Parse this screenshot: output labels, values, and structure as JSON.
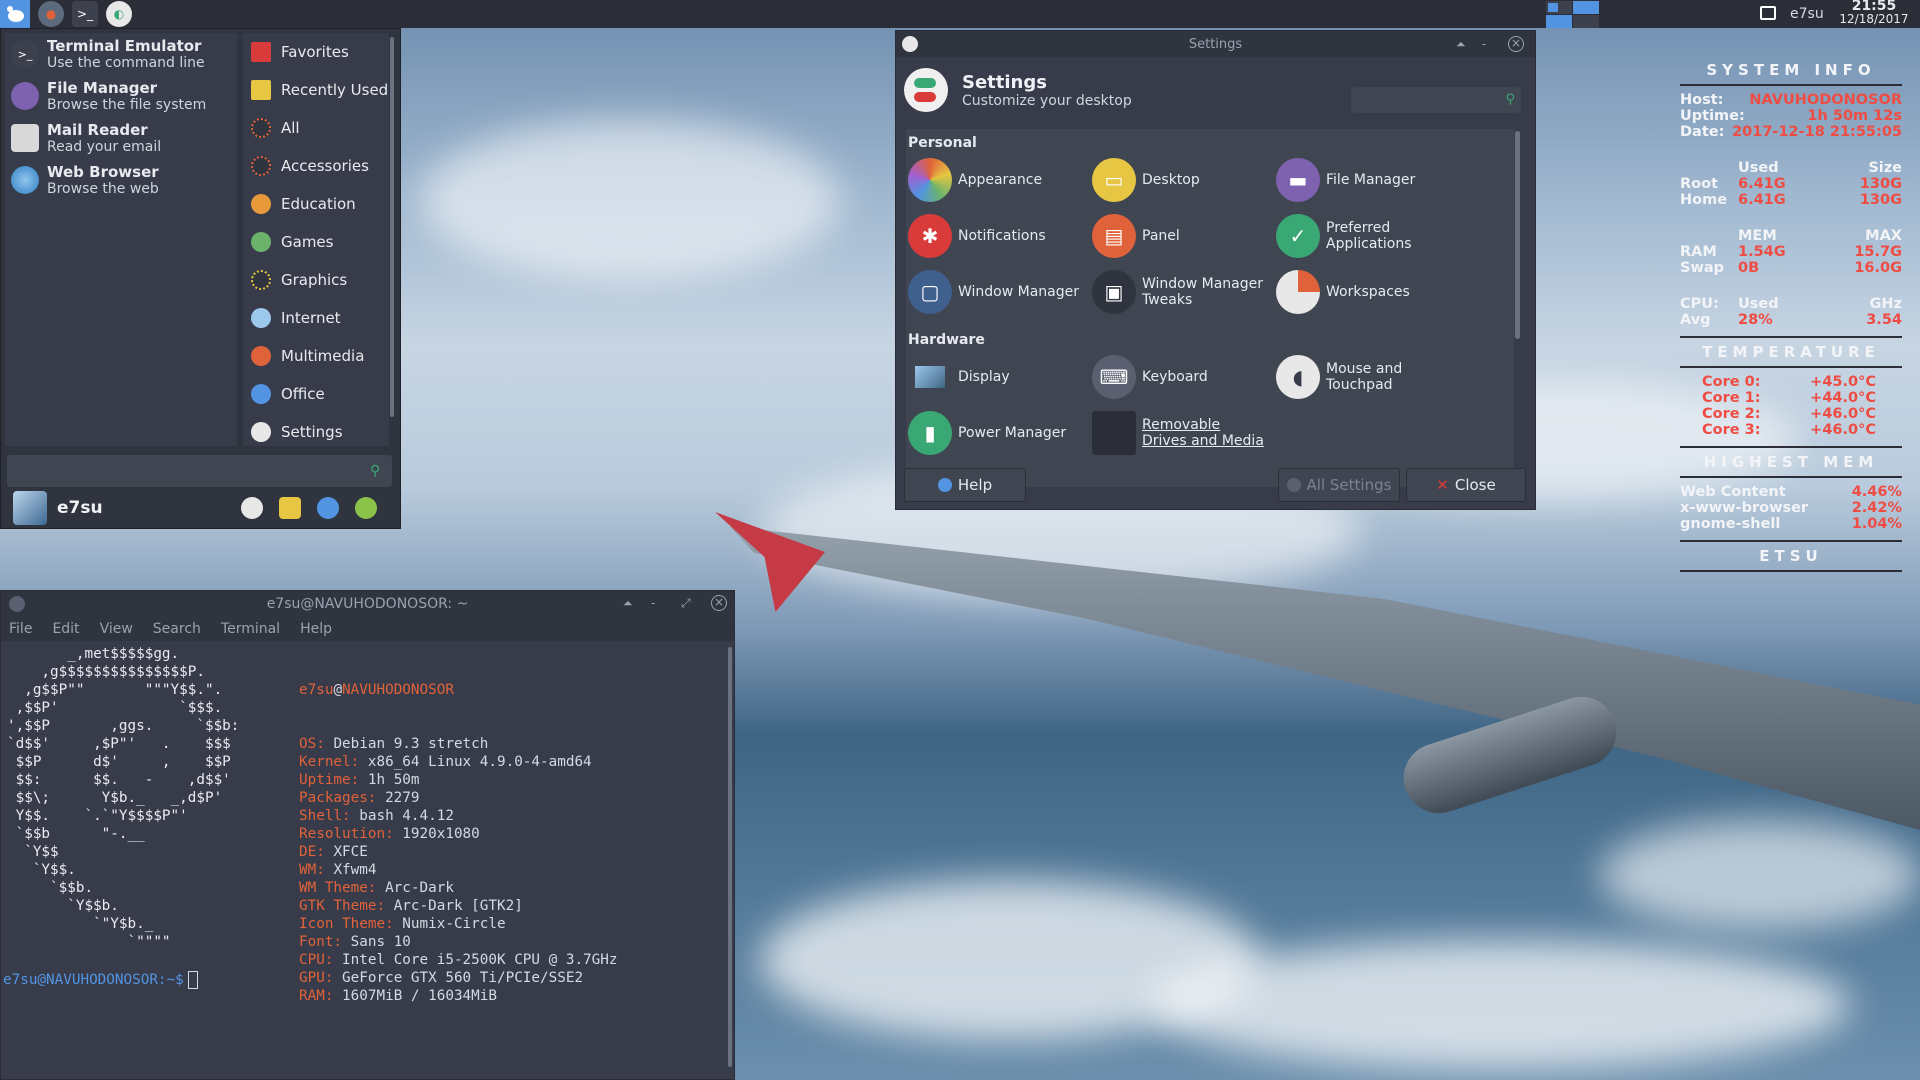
{
  "desktop": {
    "background": "airplane-wing-over-clouds"
  },
  "top_panel": {
    "launchers": [
      "whisker-menu",
      "firefox",
      "terminal",
      "settings-manager"
    ],
    "user": "e7su",
    "clock_time": "21:55",
    "clock_date": "12/18/2017"
  },
  "whisker": {
    "favorites": [
      {
        "name": "Terminal Emulator",
        "desc": "Use the command line",
        "icon": "terminal-icon"
      },
      {
        "name": "File Manager",
        "desc": "Browse the file system",
        "icon": "file-manager-icon"
      },
      {
        "name": "Mail Reader",
        "desc": "Read your email",
        "icon": "mail-icon"
      },
      {
        "name": "Web Browser",
        "desc": "Browse the web",
        "icon": "web-browser-icon"
      }
    ],
    "categories": [
      "Favorites",
      "Recently Used",
      "All",
      "Accessories",
      "Education",
      "Games",
      "Graphics",
      "Internet",
      "Multimedia",
      "Office",
      "Settings"
    ],
    "search_placeholder": "",
    "username": "e7su"
  },
  "settings": {
    "window_title": "Settings",
    "heading": "Settings",
    "subheading": "Customize your desktop",
    "section_personal": "Personal",
    "section_hardware": "Hardware",
    "personal_items": [
      [
        "Appearance"
      ],
      [
        "Desktop"
      ],
      [
        "File Manager"
      ],
      [
        "Notifications"
      ],
      [
        "Panel"
      ],
      [
        "Preferred",
        "Applications"
      ],
      [
        "Window Manager"
      ],
      [
        "Window Manager",
        "Tweaks"
      ],
      [
        "Workspaces"
      ]
    ],
    "hardware_items": [
      [
        "Display"
      ],
      [
        "Keyboard"
      ],
      [
        "Mouse and",
        "Touchpad"
      ],
      [
        "Power Manager"
      ],
      [
        "Removable",
        "Drives and Media"
      ]
    ],
    "help_label": "Help",
    "all_settings_label": "All Settings",
    "close_label": "Close"
  },
  "terminal": {
    "title": "e7su@NAVUHODONOSOR: ~",
    "menu": [
      "File",
      "Edit",
      "View",
      "Search",
      "Terminal",
      "Help"
    ],
    "ascii_art": "       _,met$$$$$gg.\n    ,g$$$$$$$$$$$$$$$P.\n  ,g$$P\"\"       \"\"\"Y$$.\".\n ,$$P'              `$$$.\n',$$P       ,ggs.     `$$b:\n`d$$'     ,$P\"'   .    $$$\n $$P      d$'     ,    $$P\n $$:      $$.   -    ,d$$'\n $$\\;      Y$b._   _,d$P'\n Y$$.    `.`\"Y$$$$P\"'\n `$$b      \"-.__\n  `Y$$\n   `Y$$.\n     `$$b.\n       `Y$$b.\n          `\"Y$b._\n              `\"\"\"\"",
    "user": "e7su",
    "host": "NAVUHODONOSOR",
    "info": [
      [
        "OS:",
        "Debian 9.3 stretch"
      ],
      [
        "Kernel:",
        "x86_64 Linux 4.9.0-4-amd64"
      ],
      [
        "Uptime:",
        "1h 50m"
      ],
      [
        "Packages:",
        "2279"
      ],
      [
        "Shell:",
        "bash 4.4.12"
      ],
      [
        "Resolution:",
        "1920x1080"
      ],
      [
        "DE:",
        "XFCE"
      ],
      [
        "WM:",
        "Xfwm4"
      ],
      [
        "WM Theme:",
        "Arc-Dark"
      ],
      [
        "GTK Theme:",
        "Arc-Dark [GTK2]"
      ],
      [
        "Icon Theme:",
        "Numix-Circle"
      ],
      [
        "Font:",
        "Sans 10"
      ],
      [
        "CPU:",
        "Intel Core i5-2500K CPU @ 3.7GHz"
      ],
      [
        "GPU:",
        "GeForce GTX 560 Ti/PCIe/SSE2"
      ],
      [
        "RAM:",
        "1607MiB / 16034MiB"
      ]
    ],
    "prompt": "e7su@NAVUHODONOSOR:~$"
  },
  "conky": {
    "h_system": "SYSTEM INFO",
    "host_label": "Host:",
    "host": "NAVUHODONOSOR",
    "uptime_label": "Uptime:",
    "uptime": "1h 50m 12s",
    "date_label": "Date:",
    "date": "2017-12-18 21:55:05",
    "disk_used_h": "Used",
    "disk_size_h": "Size",
    "root_label": "Root",
    "root_used": "6.41G",
    "root_size": "130G",
    "home_label": "Home",
    "home_used": "6.41G",
    "home_size": "130G",
    "mem_h": "MEM",
    "max_h": "MAX",
    "ram_label": "RAM",
    "ram_used": "1.54G",
    "ram_max": "15.7G",
    "swap_label": "Swap",
    "swap_used": "0B",
    "swap_max": "16.0G",
    "cpu_label": "CPU:",
    "cpu_used_h": "Used",
    "cpu_ghz_h": "GHz",
    "avg_label": "Avg",
    "avg_used": "28%",
    "avg_ghz": "3.54",
    "h_temp": "TEMPERATURE",
    "cores": [
      [
        "Core 0:",
        "+45.0°C"
      ],
      [
        "Core 1:",
        "+44.0°C"
      ],
      [
        "Core 2:",
        "+46.0°C"
      ],
      [
        "Core 3:",
        "+46.0°C"
      ]
    ],
    "h_mem": "HIGHEST MEM",
    "procs": [
      [
        "Web Content",
        "4.46%"
      ],
      [
        "x-www-browser",
        "2.42%"
      ],
      [
        "gnome-shell",
        "1.04%"
      ]
    ],
    "h_etsu": "ETSU"
  }
}
